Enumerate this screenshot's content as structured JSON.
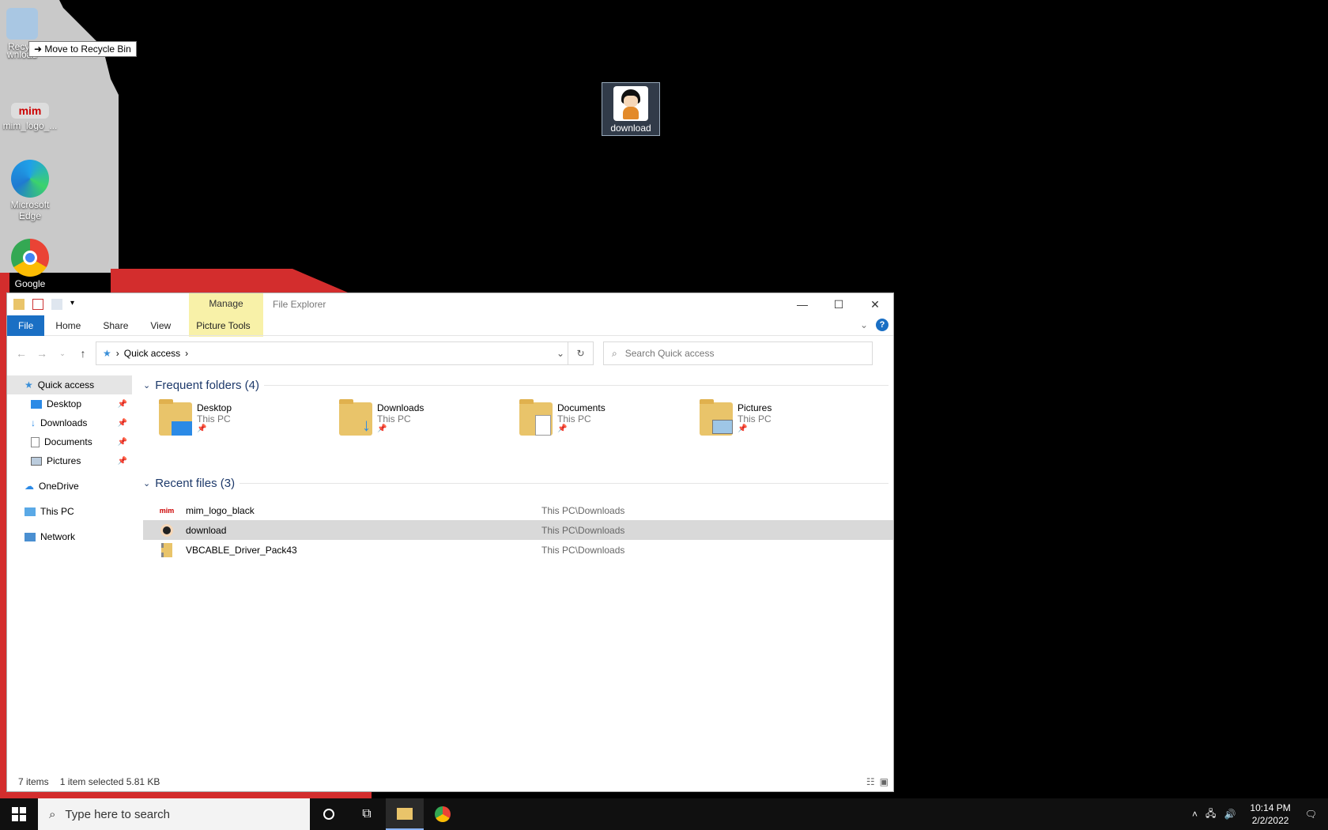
{
  "desktop": {
    "icons": [
      {
        "label": "Recycl"
      },
      {
        "label": "mim_logo_..."
      },
      {
        "label": "Microsoft Edge"
      },
      {
        "label": "Google"
      }
    ],
    "dragging_label": "wnload",
    "tooltip": "Move to Recycle Bin",
    "selected_icon_label": "download"
  },
  "explorer": {
    "title": "File Explorer",
    "context_tab": "Manage",
    "ribbon_tabs": [
      "File",
      "Home",
      "Share",
      "View",
      "Picture Tools"
    ],
    "address": {
      "crumb": "Quick access"
    },
    "search_placeholder": "Search Quick access",
    "nav": {
      "quick_access": "Quick access",
      "items": [
        "Desktop",
        "Downloads",
        "Documents",
        "Pictures"
      ],
      "onedrive": "OneDrive",
      "this_pc": "This PC",
      "network": "Network"
    },
    "frequent_header": "Frequent folders (4)",
    "folders": [
      {
        "name": "Desktop",
        "location": "This PC"
      },
      {
        "name": "Downloads",
        "location": "This PC"
      },
      {
        "name": "Documents",
        "location": "This PC"
      },
      {
        "name": "Pictures",
        "location": "This PC"
      }
    ],
    "recent_header": "Recent files (3)",
    "recent_files": [
      {
        "name": "mim_logo_black",
        "location": "This PC\\Downloads"
      },
      {
        "name": "download",
        "location": "This PC\\Downloads"
      },
      {
        "name": "VBCABLE_Driver_Pack43",
        "location": "This PC\\Downloads"
      }
    ],
    "status": {
      "count": "7 items",
      "selection": "1 item selected  5.81 KB"
    }
  },
  "taskbar": {
    "search_placeholder": "Type here to search",
    "time": "10:14 PM",
    "date": "2/2/2022"
  }
}
